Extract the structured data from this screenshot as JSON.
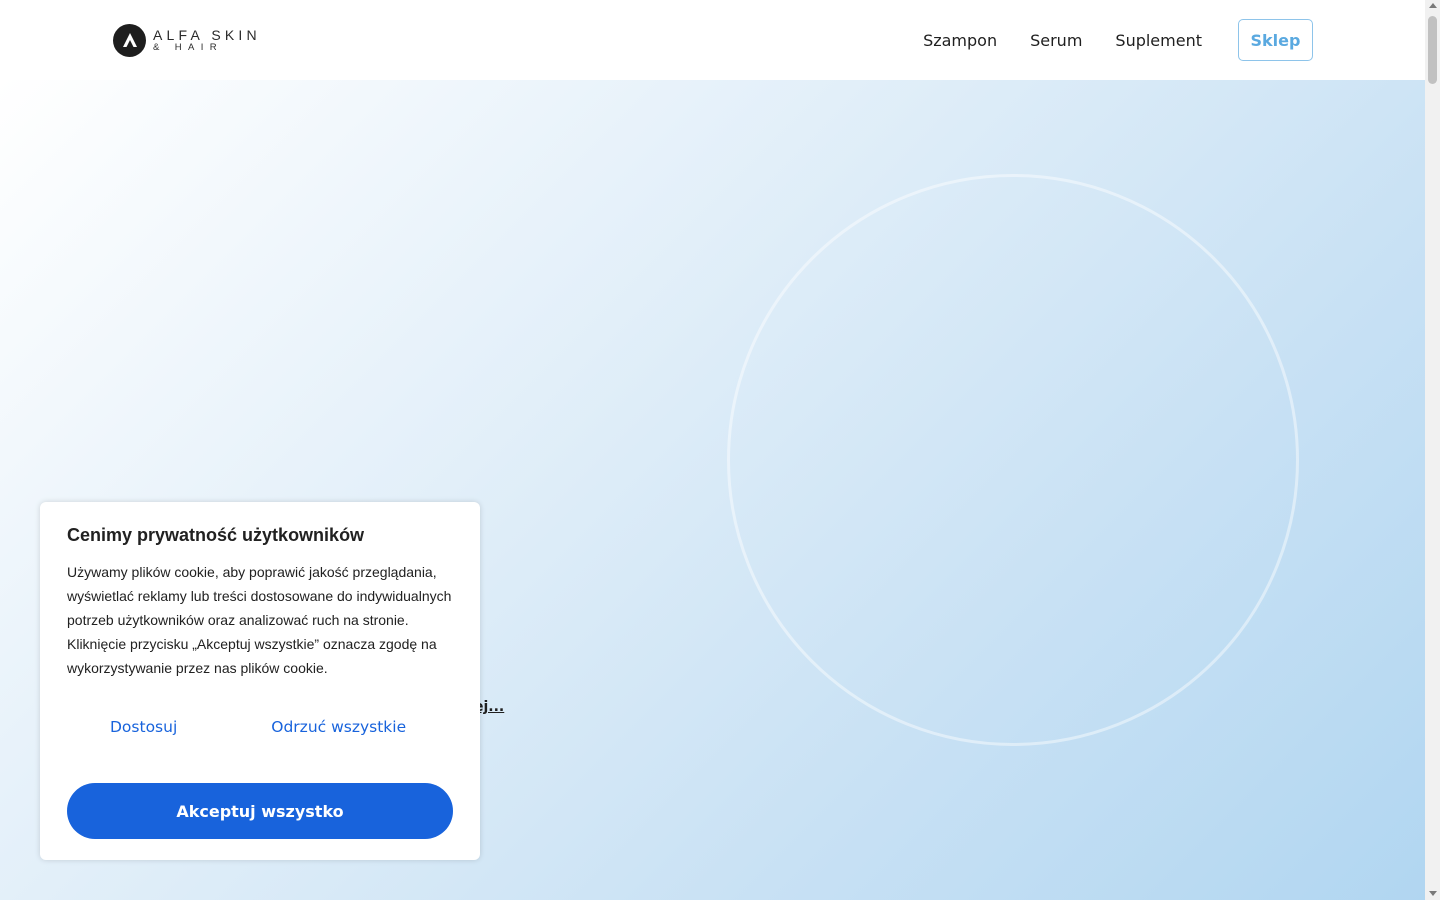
{
  "header": {
    "logo": {
      "line1": "ALFA SKIN",
      "line2": "& HAIR",
      "icon": "alfa-logo-icon"
    },
    "nav": [
      {
        "label": "Szampon"
      },
      {
        "label": "Serum"
      },
      {
        "label": "Suplement"
      }
    ],
    "shop_button": "Sklep"
  },
  "hero": {
    "link_fragment": "ej..."
  },
  "cookie_banner": {
    "title": "Cenimy prywatność użytkowników",
    "text": "Używamy plików cookie, aby poprawić jakość przeglądania, wyświetlać reklamy lub treści dostosowane do indywidualnych potrzeb użytkowników oraz analizować ruch na stronie. Kliknięcie przycisku „Akceptuj wszystkie” oznacza zgodę na wykorzystywanie przez nas plików cookie.",
    "customize_label": "Dostosuj",
    "reject_label": "Odrzuć wszystkie",
    "accept_label": "Akceptuj wszystko"
  },
  "colors": {
    "accent": "#1863dc",
    "shop_button": "#5aa9e0",
    "hero_gradient_end": "#b1d6f1"
  }
}
